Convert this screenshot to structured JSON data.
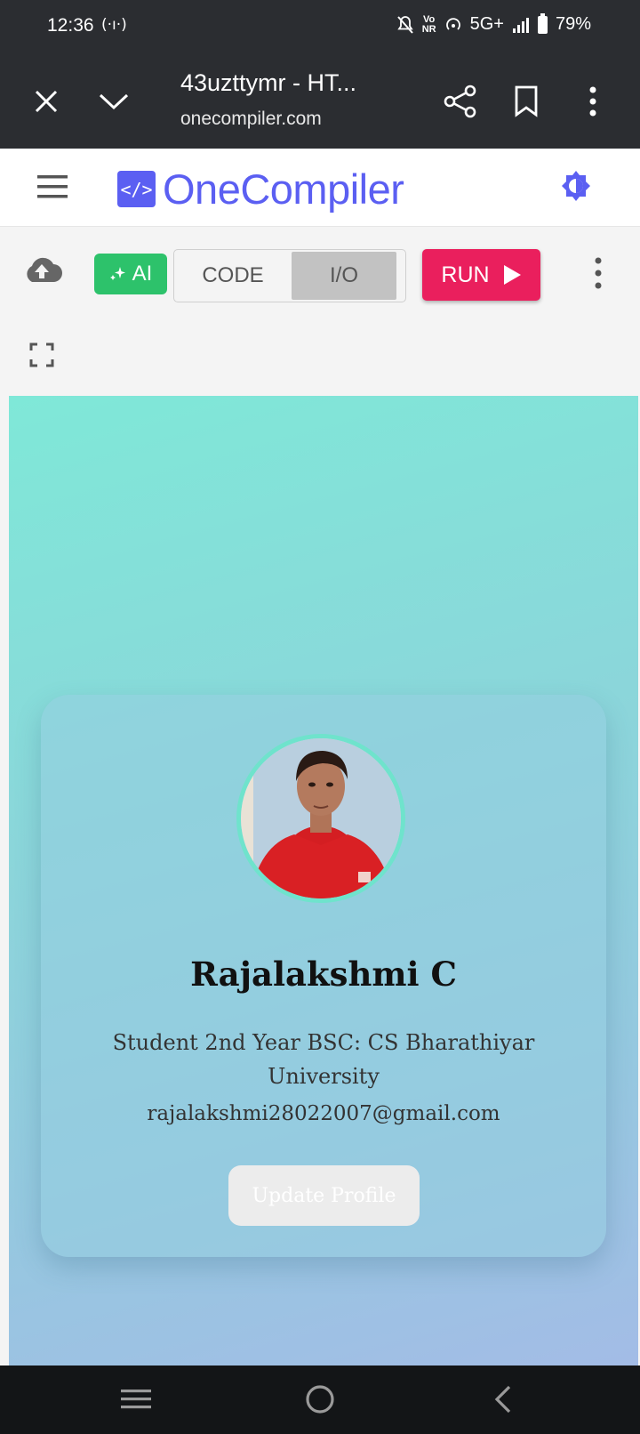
{
  "status_bar": {
    "time": "12:36",
    "network": "5G+",
    "volte": "Vo\nNR",
    "battery": "79%"
  },
  "browser": {
    "page_title": "43uzttymr - HT...",
    "domain": "onecompiler.com",
    "icons": [
      "close-icon",
      "chevron-down-icon",
      "share-icon",
      "bookmark-icon",
      "more-vert-icon"
    ]
  },
  "site": {
    "logo_glyph": "</>",
    "logo_text": "OneCompiler",
    "brand_color": "#5b5ff2"
  },
  "toolbar": {
    "ai_label": "AI",
    "tab_code": "CODE",
    "tab_io": "I/O",
    "active_tab": "I/O",
    "run_label": "RUN",
    "run_color": "#ea1f5d",
    "ai_color": "#2dc26b"
  },
  "profile": {
    "name": "Rajalakshmi C",
    "role": "Student 2nd Year BSC: CS Bharathiyar University",
    "email": "rajalakshmi28022007@gmail.com",
    "button_label": "Update Profile"
  }
}
